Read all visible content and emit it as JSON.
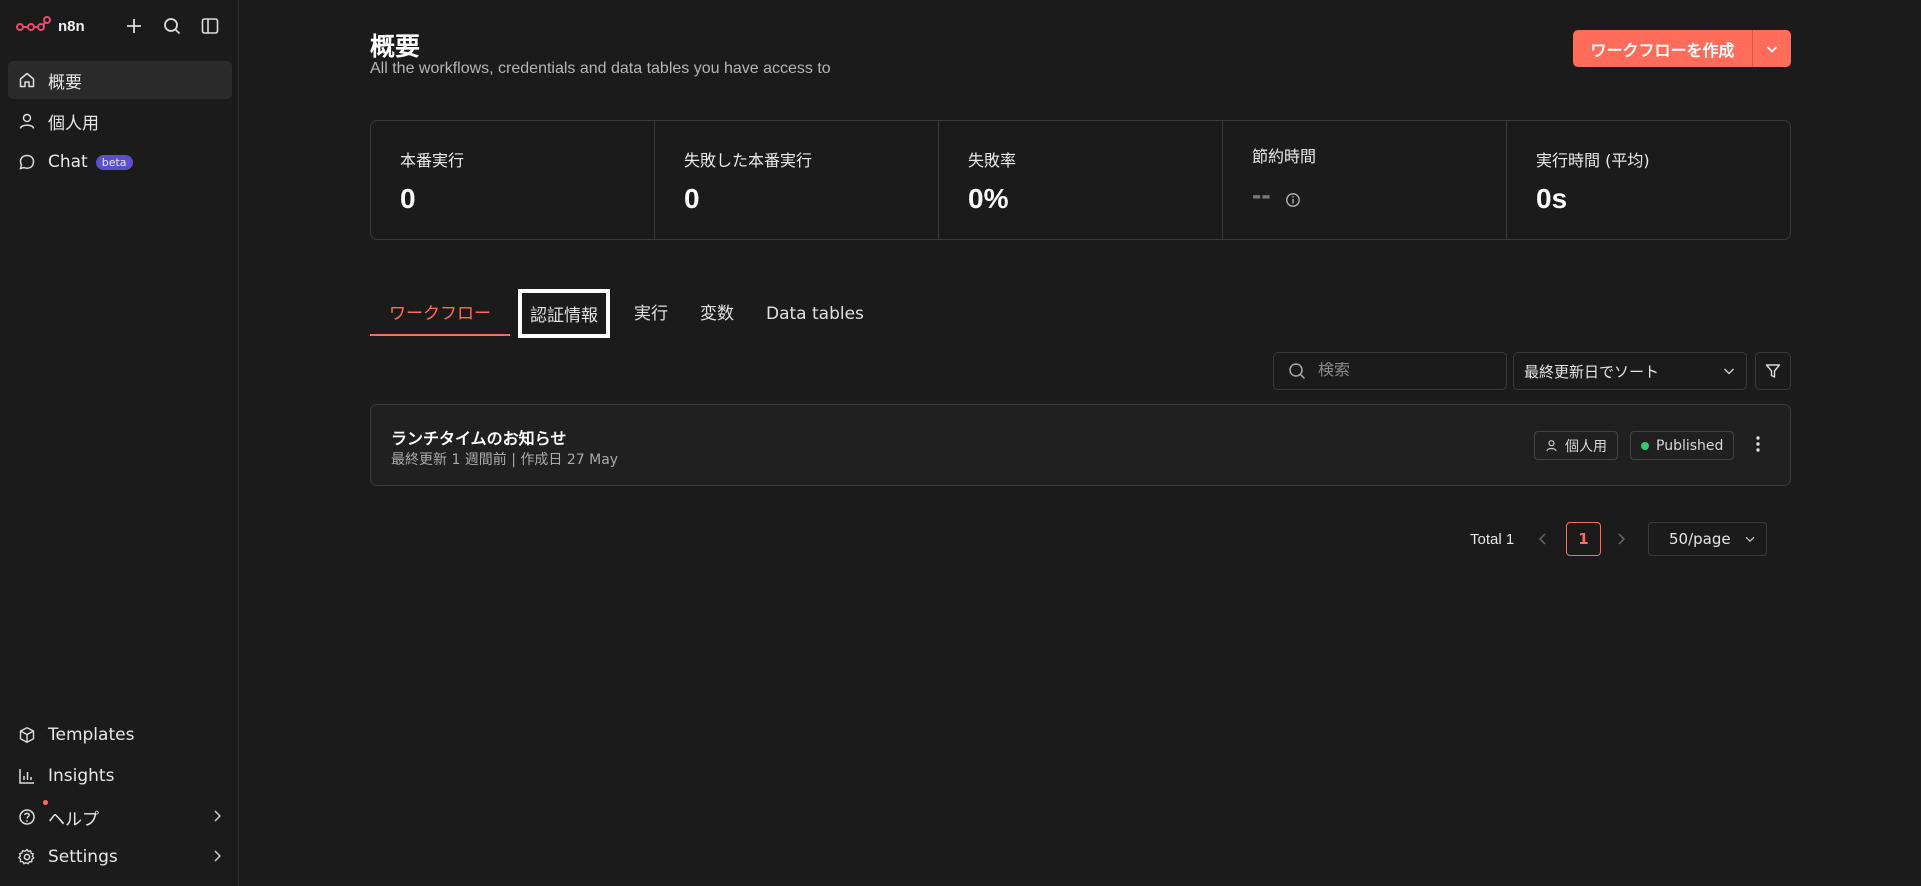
{
  "app": {
    "logo_text": "n8n"
  },
  "sidebar": {
    "items": [
      {
        "label": "概要",
        "icon": "home-icon"
      },
      {
        "label": "個人用",
        "icon": "user-icon"
      },
      {
        "label": "Chat",
        "icon": "chat-icon",
        "badge": "beta"
      }
    ],
    "bottom": [
      {
        "label": "Templates",
        "icon": "box-icon"
      },
      {
        "label": "Insights",
        "icon": "bar-chart-icon"
      },
      {
        "label": "ヘルプ",
        "icon": "help-icon"
      },
      {
        "label": "Settings",
        "icon": "gear-icon"
      }
    ]
  },
  "header": {
    "title": "概要",
    "subtitle": "All the workflows, credentials and data tables you have access to",
    "create_button": "ワークフローを作成"
  },
  "stats": [
    {
      "label": "本番実行",
      "value": "0"
    },
    {
      "label": "失敗した本番実行",
      "value": "0"
    },
    {
      "label": "失敗率",
      "value": "0%"
    },
    {
      "label": "節約時間",
      "value": "--"
    },
    {
      "label": "実行時間 (平均)",
      "value": "0s"
    }
  ],
  "tabs": [
    "ワークフロー",
    "認証情報",
    "実行",
    "変数",
    "Data tables"
  ],
  "search": {
    "placeholder": "検索"
  },
  "sort": {
    "selected": "最終更新日でソート"
  },
  "workflow": {
    "title": "ランチタイムのお知らせ",
    "meta": "最終更新 1 週間前 |  作成日 27 May",
    "project_badge": "個人用",
    "status_badge": "Published"
  },
  "pagination": {
    "total": "Total 1",
    "current": "1",
    "per_page": "50/page"
  },
  "colors": {
    "accent": "#ff6d5a",
    "published": "#2ecc71",
    "background": "#1b1b1b"
  }
}
